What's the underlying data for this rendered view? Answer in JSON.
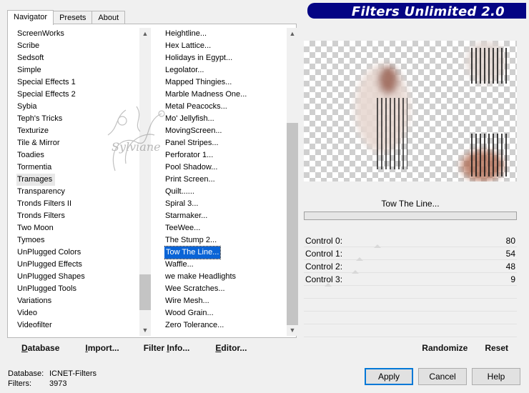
{
  "tabs": [
    "Navigator",
    "Presets",
    "About"
  ],
  "title": "Filters Unlimited 2.0",
  "categories": [
    "ScreenWorks",
    "Scribe",
    "Sedsoft",
    "Simple",
    "Special Effects 1",
    "Special Effects 2",
    "Sybia",
    "Teph's Tricks",
    "Texturize",
    "Tile & Mirror",
    "Toadies",
    "Tormentia",
    "Tramages",
    "Transparency",
    "Tronds Filters II",
    "Tronds Filters",
    "Two Moon",
    "Tymoes",
    "UnPlugged Colors",
    "UnPlugged Effects",
    "UnPlugged Shapes",
    "UnPlugged Tools",
    "Variations",
    "Video",
    "Videofilter"
  ],
  "selected_category": "Tramages",
  "filters": [
    "Heightline...",
    "Hex Lattice...",
    "Holidays in Egypt...",
    "Legolator...",
    "Mapped Thingies...",
    "Marble Madness One...",
    "Metal Peacocks...",
    "Mo' Jellyfish...",
    "MovingScreen...",
    "Panel Stripes...",
    "Perforator 1...",
    "Pool Shadow...",
    "Print Screen...",
    "Quilt......",
    "Spiral 3...",
    "Starmaker...",
    "TeeWee...",
    "The Stump 2...",
    "Tow The Line...",
    "Waffle...",
    "we make Headlights",
    "Wee Scratches...",
    "Wire Mesh...",
    "Wood Grain...",
    "Zero Tolerance..."
  ],
  "selected_filter": "Tow The Line...",
  "bottom_buttons": {
    "database": {
      "u": "D",
      "rest": "atabase"
    },
    "import": {
      "pre": "",
      "u": "I",
      "rest": "mport..."
    },
    "filter_info": {
      "pre": "Filter ",
      "u": "I",
      "rest": "nfo..."
    },
    "editor": {
      "pre": "",
      "u": "E",
      "rest": "ditor..."
    }
  },
  "preview": {
    "filter_name": "Tow The Line..."
  },
  "controls": [
    {
      "label": "Control 0:",
      "value": 80
    },
    {
      "label": "Control 1:",
      "value": 54
    },
    {
      "label": "Control 2:",
      "value": 48
    },
    {
      "label": "Control 3:",
      "value": 9
    }
  ],
  "right_buttons": {
    "randomize": "Randomize",
    "reset": "Reset"
  },
  "status": {
    "database_label": "Database:",
    "database_value": "ICNET-Filters",
    "filters_label": "Filters:",
    "filters_value": "3973"
  },
  "dialog_buttons": {
    "apply": "Apply",
    "cancel": "Cancel",
    "help": "Help"
  },
  "watermark_text": "Sylviane",
  "colors": {
    "accent": "#0a64d6",
    "title_bg": "#040484"
  }
}
